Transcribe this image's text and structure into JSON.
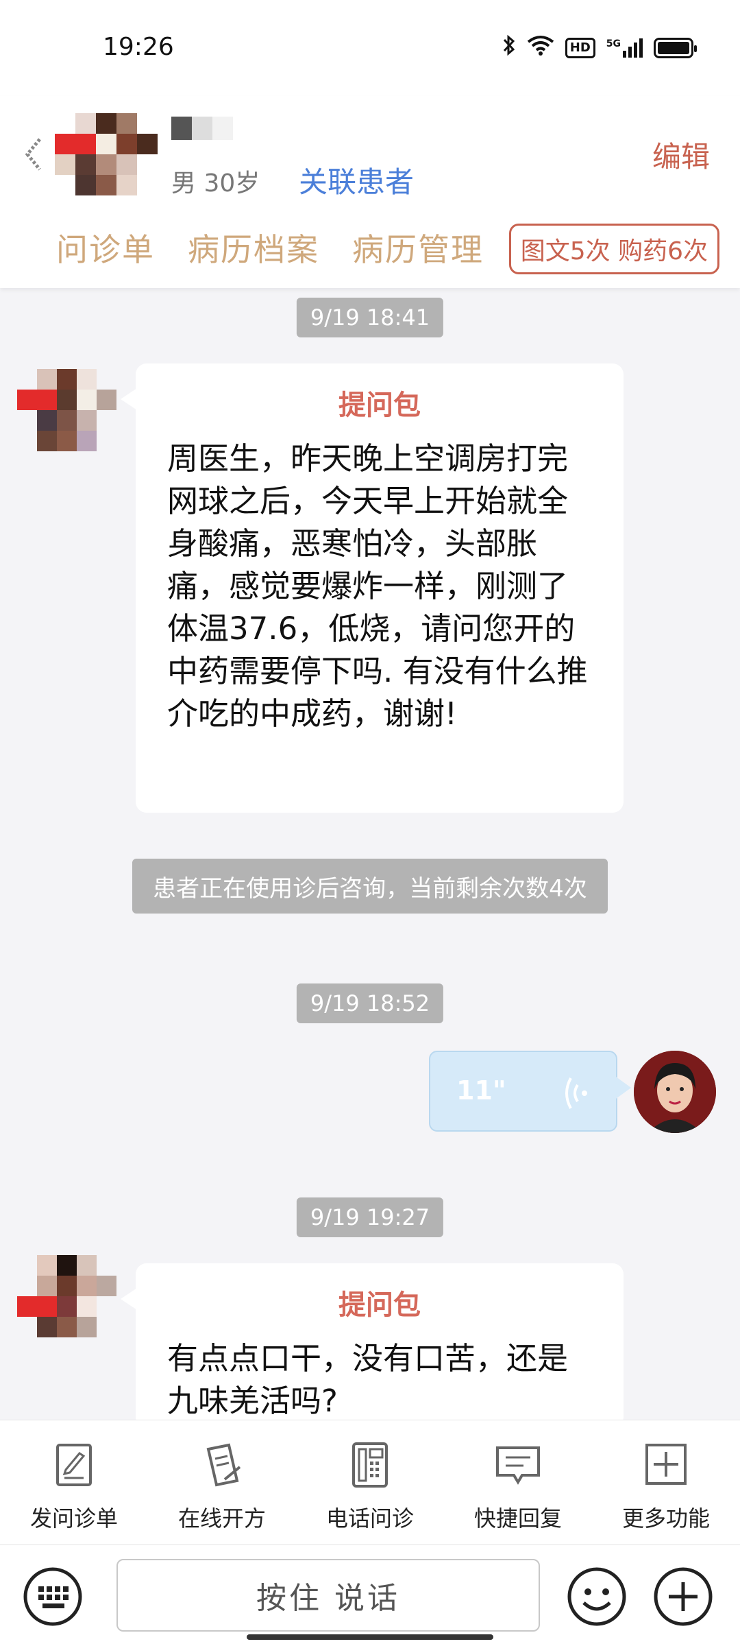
{
  "status_bar": {
    "time": "19:26",
    "network_badge": "HD",
    "signal_label": "5G"
  },
  "header": {
    "patient_gender_age": "男 30岁",
    "link_patient": "关联患者",
    "edit": "编辑",
    "tabs": [
      "问诊单",
      "病历档案",
      "病历管理"
    ],
    "service_badge": "图文5次 购药6次"
  },
  "chat": {
    "messages": [
      {
        "timestamp": "9/19 18:41",
        "bubble_title": "提问包",
        "text": "周医生，昨天晚上空调房打完网球之后，今天早上开始就全身酸痛，恶寒怕冷，头部胀痛，感觉要爆炸一样，刚测了体温37.6，低烧，请问您开的中药需要停下吗. 有没有什么推介吃的中成药，谢谢!"
      },
      {
        "notice": "患者正在使用诊后咨询，当前剩余次数4次"
      },
      {
        "timestamp": "9/19 18:52",
        "voice_duration": "11\""
      },
      {
        "timestamp": "9/19 19:27",
        "bubble_title": "提问包",
        "text": "有点点口干，没有口苦，还是九味羌活吗?"
      }
    ]
  },
  "toolbar": {
    "items": [
      {
        "label": "发问诊单",
        "icon": "form-edit-icon"
      },
      {
        "label": "在线开方",
        "icon": "prescription-icon"
      },
      {
        "label": "电话问诊",
        "icon": "phone-icon"
      },
      {
        "label": "快捷回复",
        "icon": "quick-reply-icon"
      },
      {
        "label": "更多功能",
        "icon": "more-plus-icon"
      }
    ]
  },
  "input_bar": {
    "hold_to_talk": "按住 说话"
  },
  "colors": {
    "accent": "#c8624f",
    "link": "#4b7fd9",
    "tab": "#cfa87c",
    "bubble_title": "#d5685a",
    "voice_bubble": "#d6eaf9"
  }
}
